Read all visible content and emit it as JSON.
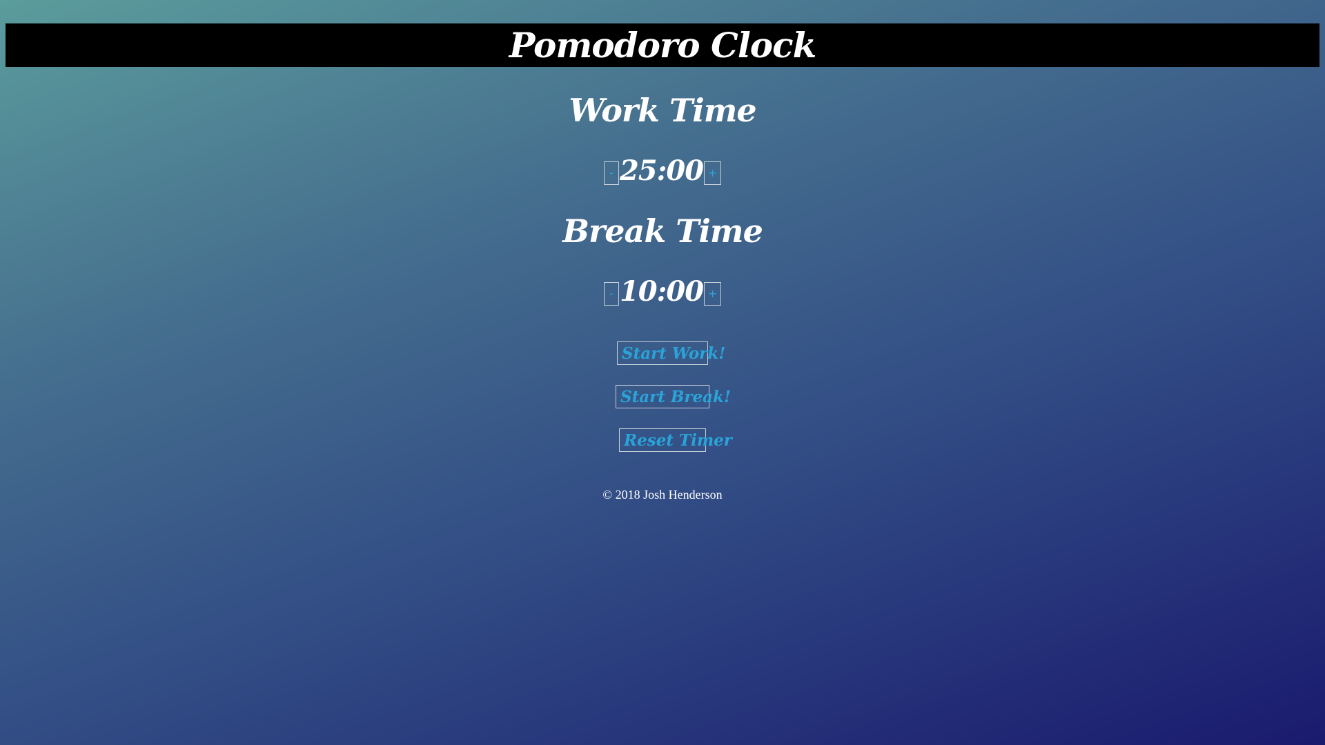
{
  "header": {
    "title": "Pomodoro Clock"
  },
  "work": {
    "heading": "Work Time",
    "decrement_label": "-",
    "time": "25:00",
    "increment_label": "+"
  },
  "break": {
    "heading": "Break Time",
    "decrement_label": "-",
    "time": "10:00",
    "increment_label": "+"
  },
  "actions": {
    "start_work": "Start Work!",
    "start_break": "Start Break!",
    "reset_timer": "Reset Timer"
  },
  "footer": {
    "copyright": "© 2018 Josh Henderson"
  },
  "colors": {
    "header_bg": "#000000",
    "button_text": "#2aa4d8",
    "gradient_start": "#5b9c9c",
    "gradient_end": "#1a1a6e"
  }
}
